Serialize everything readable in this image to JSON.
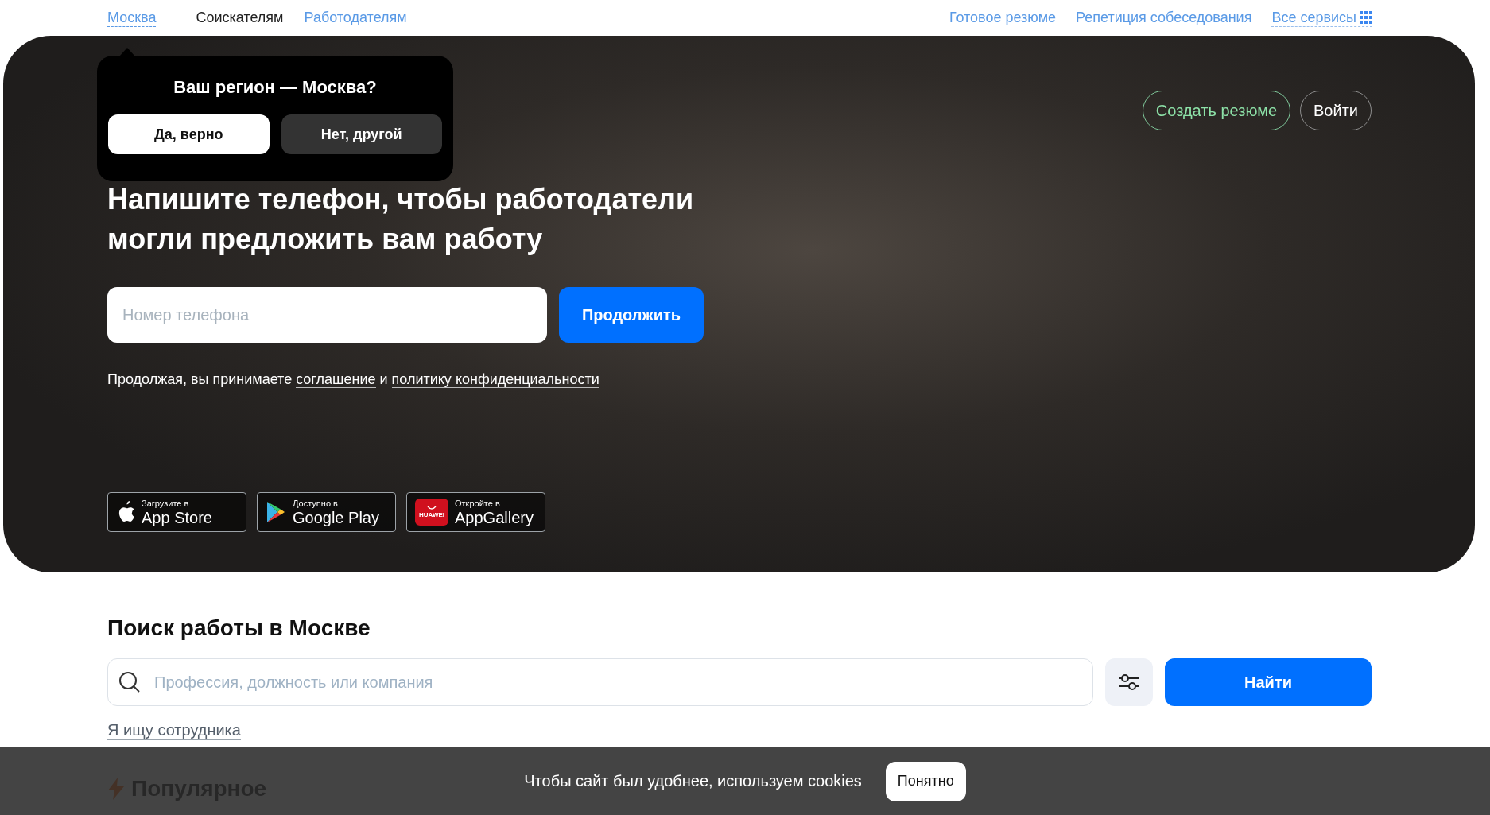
{
  "top_nav": {
    "region_link": "Москва",
    "audience_tabs": [
      {
        "label": "Соискателям",
        "selected": true
      },
      {
        "label": "Работодателям",
        "selected": false
      }
    ],
    "service_links": [
      {
        "label": "Готовое резюме",
        "kind": "plain"
      },
      {
        "label": "Репетиция собеседования",
        "kind": "plain"
      },
      {
        "label": "Все сервисы",
        "kind": "menu"
      }
    ]
  },
  "region_popup": {
    "title": "Ваш регион — Москва?",
    "buttons": [
      {
        "label": "Да, верно",
        "kind": "primary"
      },
      {
        "label": "Нет, другой",
        "kind": "secondary"
      }
    ]
  },
  "hero": {
    "auth_buttons": [
      {
        "label": "Создать резюме",
        "kind": "accent"
      },
      {
        "label": "Войти",
        "kind": "plain"
      }
    ],
    "headline": "Напишите телефон, чтобы работодатели могли предложить вам работу",
    "phone_field": {
      "placeholder": "Номер телефона"
    },
    "submit_button": "Продолжить",
    "agreement": [
      {
        "kind": "text",
        "text": "Продолжая, вы принимаете "
      },
      {
        "kind": "link",
        "text": "соглашение"
      },
      {
        "kind": "text",
        "text": " и "
      },
      {
        "kind": "link",
        "text": "политику конфиденциальности"
      }
    ],
    "app_badges": [
      {
        "kind": "apple",
        "caption": "Загрузите в",
        "store": "App Store"
      },
      {
        "kind": "google",
        "caption": "Доступно в",
        "store": "Google Play"
      },
      {
        "kind": "huawei",
        "caption": "Откройте в",
        "store": "AppGallery",
        "logo_label": "HUAWEI"
      }
    ]
  },
  "job_search": {
    "title": "Поиск работы в Москве",
    "search_field": {
      "placeholder": "Профессия, должность или компания"
    },
    "submit_button": "Найти",
    "employer_link": "Я ищу сотрудника"
  },
  "popular": {
    "title": "Популярное"
  },
  "cookie_banner": {
    "parts": [
      {
        "kind": "text",
        "text": "Чтобы сайт был удобнее, используем "
      },
      {
        "kind": "link",
        "text": "cookies"
      }
    ],
    "button": "Понятно"
  }
}
